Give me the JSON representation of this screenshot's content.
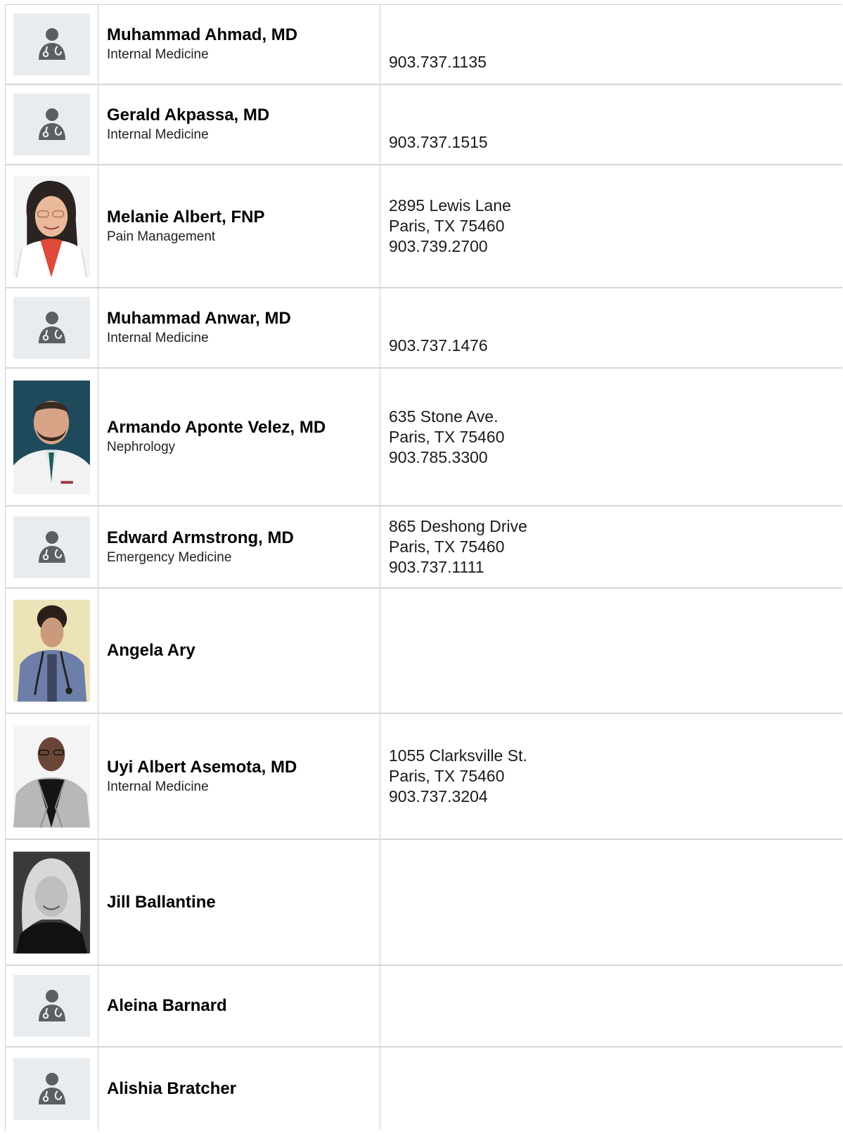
{
  "providers": [
    {
      "name": "Muhammad Ahmad, MD",
      "specialty": "Internal Medicine",
      "address_line1": "",
      "address_line2": "",
      "phone": "903.737.1135"
    },
    {
      "name": "Gerald Akpassa, MD",
      "specialty": "Internal Medicine",
      "address_line1": "",
      "address_line2": "",
      "phone": "903.737.1515"
    },
    {
      "name": "Melanie Albert, FNP",
      "specialty": "Pain Management",
      "address_line1": "2895 Lewis Lane",
      "address_line2": "Paris, TX 75460",
      "phone": "903.739.2700"
    },
    {
      "name": "Muhammad Anwar, MD",
      "specialty": "Internal Medicine",
      "address_line1": "",
      "address_line2": "",
      "phone": "903.737.1476"
    },
    {
      "name": "Armando Aponte Velez, MD",
      "specialty": "Nephrology",
      "address_line1": "635 Stone Ave.",
      "address_line2": "Paris, TX 75460",
      "phone": "903.785.3300"
    },
    {
      "name": "Edward Armstrong, MD",
      "specialty": "Emergency Medicine",
      "address_line1": "865 Deshong Drive",
      "address_line2": "Paris, TX 75460",
      "phone": "903.737.1111"
    },
    {
      "name": "Angela Ary",
      "specialty": "",
      "address_line1": "",
      "address_line2": "",
      "phone": ""
    },
    {
      "name": "Uyi Albert Asemota, MD",
      "specialty": "Internal Medicine",
      "address_line1": "1055 Clarksville St.",
      "address_line2": "Paris, TX 75460",
      "phone": "903.737.3204"
    },
    {
      "name": "Jill Ballantine",
      "specialty": "",
      "address_line1": "",
      "address_line2": "",
      "phone": ""
    },
    {
      "name": "Aleina Barnard",
      "specialty": "",
      "address_line1": "",
      "address_line2": "",
      "phone": ""
    },
    {
      "name": "Alishia Bratcher",
      "specialty": "",
      "address_line1": "",
      "address_line2": "",
      "phone": ""
    }
  ],
  "icons": {
    "placeholder": "doctor-placeholder-icon",
    "placeholder_color": "#5b5f63",
    "placeholder_bg": "#e9ecef"
  }
}
